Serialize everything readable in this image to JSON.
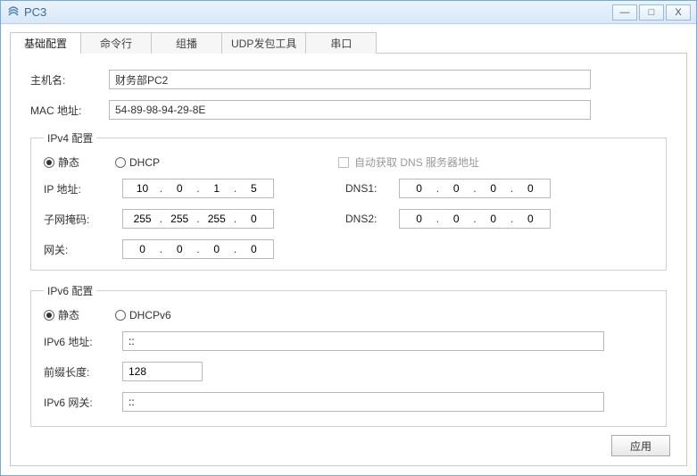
{
  "window": {
    "title": "PC3"
  },
  "tabs": {
    "basic": "基础配置",
    "cli": "命令行",
    "multicast": "组播",
    "udp": "UDP发包工具",
    "serial": "串口"
  },
  "basic": {
    "hostname_label": "主机名:",
    "hostname_value": "财务部PC2",
    "mac_label": "MAC 地址:",
    "mac_value": "54-89-98-94-29-8E"
  },
  "ipv4": {
    "legend": "IPv4 配置",
    "static_label": "静态",
    "dhcp_label": "DHCP",
    "auto_dns_label": "自动获取 DNS 服务器地址",
    "ip_label": "IP 地址:",
    "ip": {
      "o1": "10",
      "o2": "0",
      "o3": "1",
      "o4": "5"
    },
    "mask_label": "子网掩码:",
    "mask": {
      "o1": "255",
      "o2": "255",
      "o3": "255",
      "o4": "0"
    },
    "gw_label": "网关:",
    "gw": {
      "o1": "0",
      "o2": "0",
      "o3": "0",
      "o4": "0"
    },
    "dns1_label": "DNS1:",
    "dns1": {
      "o1": "0",
      "o2": "0",
      "o3": "0",
      "o4": "0"
    },
    "dns2_label": "DNS2:",
    "dns2": {
      "o1": "0",
      "o2": "0",
      "o3": "0",
      "o4": "0"
    }
  },
  "ipv6": {
    "legend": "IPv6 配置",
    "static_label": "静态",
    "dhcp_label": "DHCPv6",
    "addr_label": "IPv6 地址:",
    "addr_value": "::",
    "prefix_label": "前缀长度:",
    "prefix_value": "128",
    "gw_label": "IPv6 网关:",
    "gw_value": "::"
  },
  "buttons": {
    "apply": "应用"
  }
}
